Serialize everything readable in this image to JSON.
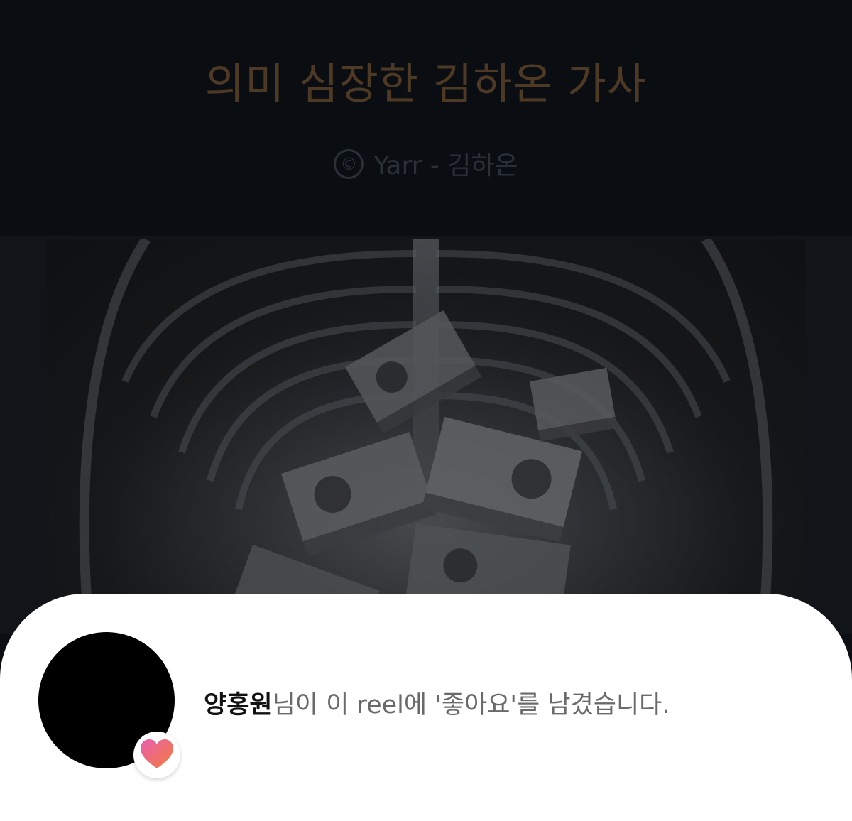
{
  "song": {
    "title": "의미 심장한 김하온 가사",
    "credit": "Yarr - 김하온"
  },
  "icons": {
    "copyright": "copyright-icon",
    "heart": "heart-icon"
  },
  "colors": {
    "title": "#4e3925",
    "credit": "#2a3037",
    "heart_top": "#e95fb0",
    "heart_bottom": "#f27c3a"
  },
  "notification": {
    "user": "양홍원",
    "message": "님이 이 reel에 '좋아요'를 남겼습니다."
  }
}
